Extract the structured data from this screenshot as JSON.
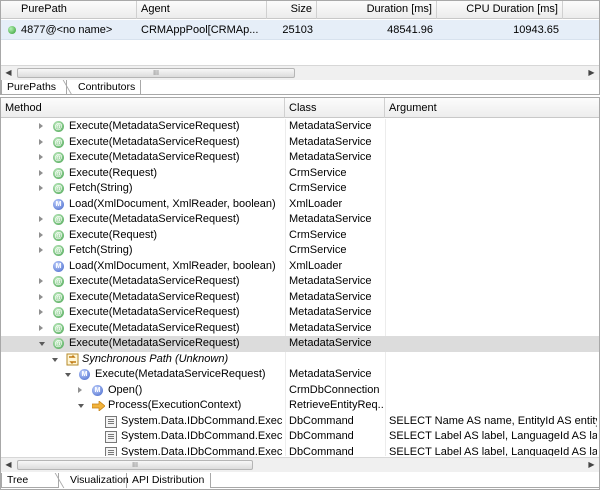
{
  "top_table": {
    "columns": [
      "PurePath",
      "Agent",
      "Size",
      "Duration [ms]",
      "CPU Duration [ms]"
    ],
    "row": {
      "purepath": "4877@<no name>",
      "agent": "CRMAppPool[CRMAp...",
      "size": "25103",
      "duration": "48541.96",
      "cpu": "10943.65"
    }
  },
  "top_tabs": [
    "PurePaths",
    "Contributors"
  ],
  "scroll_grip": "III",
  "bottom_table": {
    "columns": [
      "Method",
      "Class",
      "Argument"
    ],
    "rows": [
      {
        "indent": 1,
        "twisty": "right",
        "icon": "at",
        "method": "Execute(MetadataServiceRequest)",
        "class": "MetadataService",
        "argument": ""
      },
      {
        "indent": 1,
        "twisty": "right",
        "icon": "at",
        "method": "Execute(MetadataServiceRequest)",
        "class": "MetadataService",
        "argument": ""
      },
      {
        "indent": 1,
        "twisty": "right",
        "icon": "at",
        "method": "Execute(MetadataServiceRequest)",
        "class": "MetadataService",
        "argument": ""
      },
      {
        "indent": 1,
        "twisty": "right",
        "icon": "at",
        "method": "Execute(Request)",
        "class": "CrmService",
        "argument": ""
      },
      {
        "indent": 1,
        "twisty": "right",
        "icon": "at",
        "method": "Fetch(String)",
        "class": "CrmService",
        "argument": ""
      },
      {
        "indent": 1,
        "twisty": "none",
        "icon": "m",
        "method": "Load(XmlDocument, XmlReader, boolean)",
        "class": "XmlLoader",
        "argument": ""
      },
      {
        "indent": 1,
        "twisty": "right",
        "icon": "at",
        "method": "Execute(MetadataServiceRequest)",
        "class": "MetadataService",
        "argument": ""
      },
      {
        "indent": 1,
        "twisty": "right",
        "icon": "at",
        "method": "Execute(Request)",
        "class": "CrmService",
        "argument": ""
      },
      {
        "indent": 1,
        "twisty": "right",
        "icon": "at",
        "method": "Fetch(String)",
        "class": "CrmService",
        "argument": ""
      },
      {
        "indent": 1,
        "twisty": "none",
        "icon": "m",
        "method": "Load(XmlDocument, XmlReader, boolean)",
        "class": "XmlLoader",
        "argument": ""
      },
      {
        "indent": 1,
        "twisty": "right",
        "icon": "at",
        "method": "Execute(MetadataServiceRequest)",
        "class": "MetadataService",
        "argument": ""
      },
      {
        "indent": 1,
        "twisty": "right",
        "icon": "at",
        "method": "Execute(MetadataServiceRequest)",
        "class": "MetadataService",
        "argument": ""
      },
      {
        "indent": 1,
        "twisty": "right",
        "icon": "at",
        "method": "Execute(MetadataServiceRequest)",
        "class": "MetadataService",
        "argument": ""
      },
      {
        "indent": 1,
        "twisty": "right",
        "icon": "at",
        "method": "Execute(MetadataServiceRequest)",
        "class": "MetadataService",
        "argument": ""
      },
      {
        "indent": 1,
        "twisty": "down",
        "icon": "at",
        "method": "Execute(MetadataServiceRequest)",
        "class": "MetadataService",
        "argument": "",
        "selected": true
      },
      {
        "indent": 2,
        "twisty": "down",
        "icon": "sync",
        "method": "Synchronous Path (Unknown)",
        "class": "",
        "argument": "",
        "italic": true
      },
      {
        "indent": 3,
        "twisty": "down",
        "icon": "m",
        "method": "Execute(MetadataServiceRequest)",
        "class": "MetadataService",
        "argument": ""
      },
      {
        "indent": 4,
        "twisty": "right",
        "icon": "m",
        "method": "Open()",
        "class": "CrmDbConnection",
        "argument": ""
      },
      {
        "indent": 4,
        "twisty": "down",
        "icon": "arrow",
        "method": "Process(ExecutionContext)",
        "class": "RetrieveEntityReq...",
        "argument": ""
      },
      {
        "indent": 5,
        "twisty": "none",
        "icon": "db",
        "method": "System.Data.IDbCommand.ExecuteRe",
        "class": "DbCommand",
        "argument": "SELECT Name AS name, EntityId AS entityid, ..."
      },
      {
        "indent": 5,
        "twisty": "none",
        "icon": "db",
        "method": "System.Data.IDbCommand.ExecuteRe",
        "class": "DbCommand",
        "argument": "SELECT Label AS label, LanguageId AS langu..."
      },
      {
        "indent": 5,
        "twisty": "none",
        "icon": "db",
        "method": "System.Data.IDbCommand.ExecuteRe",
        "class": "DbCommand",
        "argument": "SELECT Label AS label, LanguageId AS langu..."
      }
    ]
  },
  "bottom_tabs": [
    "Tree",
    "Visualization",
    "API Distribution"
  ]
}
